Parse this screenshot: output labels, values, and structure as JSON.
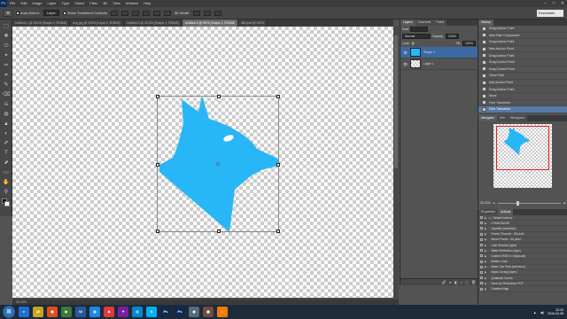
{
  "app": {
    "logo": "Ps"
  },
  "menu": [
    "File",
    "Edit",
    "Image",
    "Layer",
    "Type",
    "Select",
    "Filter",
    "3D",
    "View",
    "Window",
    "Help"
  ],
  "window_controls": [
    "–",
    "□",
    "✕"
  ],
  "options": {
    "auto_select_label": "Auto-Select:",
    "auto_select_value": "Layer",
    "show_transform_label": "Show Transform Controls",
    "mode_label": "3D Mode:",
    "workspace": "Essentials"
  },
  "tabs": [
    {
      "label": "Untitled-1 @ 100% (Shape 1, RGB/8)",
      "active": false
    },
    {
      "label": "dog.jpg @ 100% (Layer 0, RGB/8)",
      "active": false
    },
    {
      "label": "Untitled-2 @ 33.3% (Shape 1, RGB/8)",
      "active": false
    },
    {
      "label": "Untitled-3 @ 50% (Shape 1, RGB/8)",
      "active": true
    },
    {
      "label": "AM.psd @ 100%",
      "active": false
    }
  ],
  "status": "33.33%",
  "tools": [
    "⬚",
    "✥",
    "⬭",
    "⌖",
    "✂",
    "⌗",
    "✎",
    "⌫",
    "⎌",
    "◍",
    "▲",
    "◐",
    "✐",
    "T",
    "⬈",
    "▭",
    "✋",
    "⚲"
  ],
  "colors": {
    "shape": "#29b6f6",
    "selection_bg": "#3b6aa0",
    "history_current": "#5879a6",
    "nav_frame": "#e02020"
  },
  "layers_panel": {
    "tabs": [
      "Layers",
      "Channels",
      "Paths"
    ],
    "kind_label": "Kind",
    "blend_mode": "Normal",
    "opacity_label": "Opacity:",
    "opacity_value": "100%",
    "lock_label": "Lock:",
    "fill_label": "Fill:",
    "fill_value": "100%",
    "layers": [
      {
        "name": "Shape 1",
        "active": true
      },
      {
        "name": "Layer 1",
        "active": false
      }
    ],
    "footer_icons": [
      "🔗",
      "fx",
      "◧",
      "◐",
      "▢",
      "🗑"
    ]
  },
  "history_panel": {
    "title": "History",
    "items": [
      {
        "label": "Drag Anchor Point",
        "current": false
      },
      {
        "label": "New Path Component",
        "current": false
      },
      {
        "label": "Drag Anchor Point",
        "current": false
      },
      {
        "label": "New Anchor Point",
        "current": false
      },
      {
        "label": "Drag Anchor Point",
        "current": false
      },
      {
        "label": "Drag Control Point",
        "current": false
      },
      {
        "label": "Drag Control Point",
        "current": false
      },
      {
        "label": "Close Path",
        "current": false
      },
      {
        "label": "Add Anchor Point",
        "current": false
      },
      {
        "label": "Drag Anchor Point",
        "current": false
      },
      {
        "label": "Move",
        "current": false
      },
      {
        "label": "Free Transform",
        "current": false
      },
      {
        "label": "Free Transform",
        "current": true
      }
    ]
  },
  "navigator_panel": {
    "tabs": [
      "Navigator",
      "Info",
      "Histogram"
    ],
    "zoom": "33.33%"
  },
  "actions_panel": {
    "tabs": [
      "Properties",
      "Actions"
    ],
    "items": [
      "Default Actions",
      "CYANOGENE",
      "Vignette (selection)",
      "Frame Channel - 50 pixel",
      "Wood Frame - 50 pixel",
      "Cast Shadow (type)",
      "Water Reflection (type)",
      "Custom RGB to Grayscale",
      "Molten Lead",
      "Make Clip Path (selection)",
      "Sepia Toning (layer)",
      "Quadrant Colors",
      "Save As Photoshop PDF",
      "Gradient Map"
    ]
  },
  "taskbar": {
    "start": "⊞",
    "apps": [
      {
        "label": "e",
        "color": "#1e6fd0"
      },
      {
        "label": "📁",
        "color": "#c9a227"
      },
      {
        "label": "◉",
        "color": "#e04e1b"
      },
      {
        "label": "▶",
        "color": "#3a7a3a"
      },
      {
        "label": "W",
        "color": "#2b579a"
      },
      {
        "label": "◍",
        "color": "#1e88e5"
      },
      {
        "label": "◆",
        "color": "#e53935"
      },
      {
        "label": "✦",
        "color": "#7b1fa2"
      },
      {
        "label": "◎",
        "color": "#0288d1"
      },
      {
        "label": "S",
        "color": "#00aff0"
      },
      {
        "label": "Ps",
        "color": "#0d2a4e"
      },
      {
        "label": "Ps",
        "color": "#0d2a4e"
      },
      {
        "label": "◉",
        "color": "#546e7a"
      },
      {
        "label": "▣",
        "color": "#6d4c41"
      },
      {
        "label": "◐",
        "color": "#f57c00"
      }
    ],
    "time": "22:29",
    "date": "2016-02-08"
  }
}
